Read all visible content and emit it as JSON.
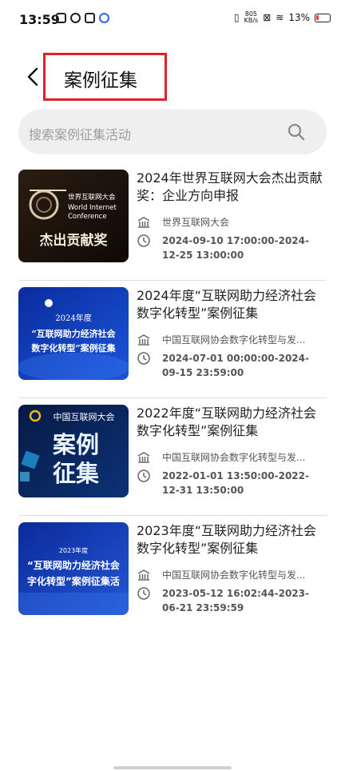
{
  "status_bar": {
    "time": "13:59",
    "net_speed": "805",
    "net_unit": "KB/s",
    "battery": "13%"
  },
  "header": {
    "back_icon": "chevron-left-icon",
    "title": "案例征集"
  },
  "search": {
    "placeholder": "搜索案例征集活动",
    "icon": "search-icon"
  },
  "items": [
    {
      "title": "2024年世界互联网大会杰出贡献奖：企业方向申报",
      "org": "世界互联网大会",
      "time": "2024-09-10 17:00:00-2024-12-25 13:00:00",
      "thumb": {
        "main_text": "杰出贡献奖",
        "sub_lines": [
          "世界互联网大会",
          "World Internet",
          "Conference"
        ],
        "colors": [
          "#1a120c",
          "#3a2616"
        ]
      }
    },
    {
      "title": "2024年度“互联网助力经济社会数字化转型”案例征集",
      "org": "中国互联网协会数字化转型与发...",
      "time": "2024-07-01 00:00:00-2024-09-15 23:59:00",
      "thumb": {
        "lines": [
          "2024年度",
          "“互联网助力经济社会",
          "数字化转型”案例征集"
        ],
        "colors": [
          "#0a2c9e",
          "#1b55d8"
        ]
      }
    },
    {
      "title": "2022年度“互联网助力经济社会数字化转型”案例征集",
      "org": "中国互联网协会数字化转型与发...",
      "time": "2022-01-01 13:50:00-2022-12-31 13:50:00",
      "thumb": {
        "top": "中国互联网大会",
        "big": [
          "案例",
          "征集"
        ],
        "colors": [
          "#061a44",
          "#0d3278"
        ]
      }
    },
    {
      "title": "2023年度“互联网助力经济社会数字化转型”案例征集",
      "org": "中国互联网协会数字化转型与发...",
      "time": "2023-05-12 16:02:44-2023-06-21 23:59:59",
      "thumb": {
        "lines": [
          "2023年度",
          "“互联网助力经济社会",
          "字化转型”案例征集活"
        ],
        "colors": [
          "#0b2a9a",
          "#2357d6"
        ]
      }
    }
  ]
}
